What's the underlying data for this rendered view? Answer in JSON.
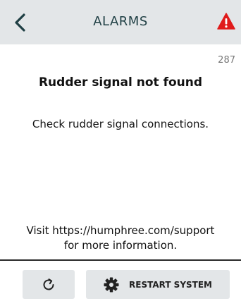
{
  "header": {
    "title": "ALARMS",
    "back_icon": "chevron-left-icon",
    "warning_icon": "warning-triangle-icon",
    "warning_color": "#e01b1b"
  },
  "alarm": {
    "code": "287",
    "title": "Rudder signal not found",
    "detail": "Check rudder signal connections.",
    "support_line1": "Visit https://humphree.com/support",
    "support_line2": "for more information."
  },
  "footer": {
    "refresh_icon": "refresh-icon",
    "restart_icon": "gear-icon",
    "restart_label": "RESTART SYSTEM"
  }
}
